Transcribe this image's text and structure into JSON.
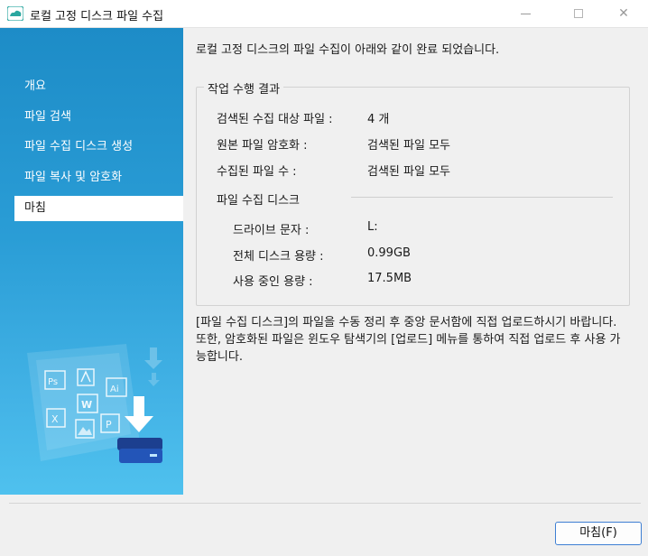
{
  "window": {
    "title": "로컬 고정 디스크 파일 수집",
    "app_icon": "cloud-icon",
    "controls": {
      "minimize": "minimize-icon",
      "maximize": "maximize-icon",
      "close_glyph": "✕"
    }
  },
  "sidebar": {
    "items": [
      {
        "label": "개요"
      },
      {
        "label": "파일 검색"
      },
      {
        "label": "파일 수집 디스크 생성"
      },
      {
        "label": "파일 복사 및 암호화"
      },
      {
        "label": "마침"
      }
    ],
    "active_index": 4,
    "illustration_icons": [
      "Ps",
      "Ai",
      "W",
      "X",
      "P"
    ]
  },
  "main": {
    "headline": "로컬 고정 디스크의 파일 수집이 아래와 같이 완료 되었습니다.",
    "result_group": {
      "title": "작업 수행 결과",
      "rows": [
        {
          "label": "검색된 수집 대상 파일 :",
          "value": "4 개"
        },
        {
          "label": "원본 파일 암호화 :",
          "value": "검색된 파일 모두"
        },
        {
          "label": "수집된 파일 수 :",
          "value": "검색된 파일 모두"
        }
      ],
      "disk_section": {
        "title": "파일 수집 디스크",
        "rows": [
          {
            "label": "드라이브 문자 :",
            "value": "L:"
          },
          {
            "label": "전체 디스크 용량 :",
            "value": "0.99GB"
          },
          {
            "label": "사용 중인 용량 :",
            "value": "17.5MB"
          }
        ]
      }
    },
    "note": "[파일 수집 디스크]의 파일을 수동 정리 후 중앙 문서함에 직접 업로드하시기 바랍니다. 또한, 암호화된 파일은 윈도우 탐색기의 [업로드] 메뉴를 통하여 직접 업로드 후 사용 가능합니다."
  },
  "footer": {
    "finish_button": "마침(F)"
  },
  "colors": {
    "sidebar_top": "#1d8cc7",
    "sidebar_bottom": "#4fc1ee",
    "button_border": "#3e7fd3"
  }
}
